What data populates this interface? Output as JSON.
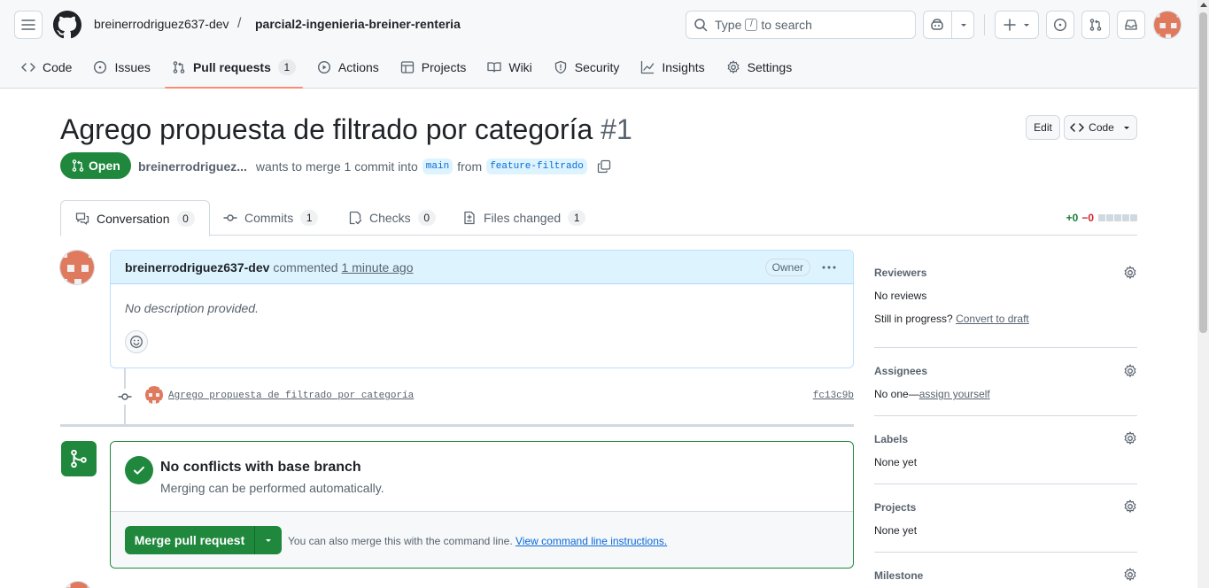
{
  "repo": {
    "owner": "breinerrodriguez637-dev",
    "separator": "/",
    "name": "parcial2-ingenieria-breiner-renteria"
  },
  "search": {
    "prefix": "Type",
    "key": "/",
    "suffix": "to search"
  },
  "nav": {
    "items": [
      {
        "label": "Code",
        "icon": "code-icon"
      },
      {
        "label": "Issues",
        "icon": "issue-opened-icon"
      },
      {
        "label": "Pull requests",
        "icon": "git-pull-request-icon",
        "count": "1",
        "active": true
      },
      {
        "label": "Actions",
        "icon": "play-icon"
      },
      {
        "label": "Projects",
        "icon": "table-icon"
      },
      {
        "label": "Wiki",
        "icon": "book-icon"
      },
      {
        "label": "Security",
        "icon": "shield-icon"
      },
      {
        "label": "Insights",
        "icon": "graph-icon"
      },
      {
        "label": "Settings",
        "icon": "gear-icon"
      }
    ]
  },
  "pr": {
    "title": "Agrego propuesta de filtrado por categoría",
    "number": "#1",
    "state": "Open",
    "author": "breinerrodriguez...",
    "merge_text": "wants to merge 1 commit into",
    "base": "main",
    "from": "from",
    "head": "feature-filtrado",
    "edit_label": "Edit",
    "code_label": "Code"
  },
  "tabs": [
    {
      "label": "Conversation",
      "count": "0",
      "icon": "comment-discussion-icon",
      "active": true
    },
    {
      "label": "Commits",
      "count": "1",
      "icon": "git-commit-icon"
    },
    {
      "label": "Checks",
      "count": "0",
      "icon": "checklist-icon"
    },
    {
      "label": "Files changed",
      "count": "1",
      "icon": "file-diff-icon"
    }
  ],
  "diffstat": {
    "additions": "+0",
    "deletions": "−0"
  },
  "comment": {
    "author": "breinerrodriguez637-dev",
    "verb": "commented",
    "time": "1 minute ago",
    "badge": "Owner",
    "body": "No description provided."
  },
  "commit": {
    "message": "Agrego propuesta de filtrado por categoría",
    "sha": "fc13c9b"
  },
  "merge": {
    "title": "No conflicts with base branch",
    "subtitle": "Merging can be performed automatically.",
    "button": "Merge pull request",
    "hint": "You can also merge this with the command line.",
    "hint_link": "View command line instructions."
  },
  "sidebar": {
    "reviewers": {
      "title": "Reviewers",
      "value": "No reviews",
      "progress_prefix": "Still in progress?",
      "progress_link": "Convert to draft"
    },
    "assignees": {
      "title": "Assignees",
      "prefix": "No one—",
      "link": "assign yourself"
    },
    "labels": {
      "title": "Labels",
      "value": "None yet"
    },
    "projects": {
      "title": "Projects",
      "value": "None yet"
    },
    "milestone": {
      "title": "Milestone"
    }
  },
  "colors": {
    "accent_green": "#1f883d",
    "link_blue": "#0969da",
    "nav_underline": "#fd8c73",
    "avatar": "#e07a5f"
  }
}
